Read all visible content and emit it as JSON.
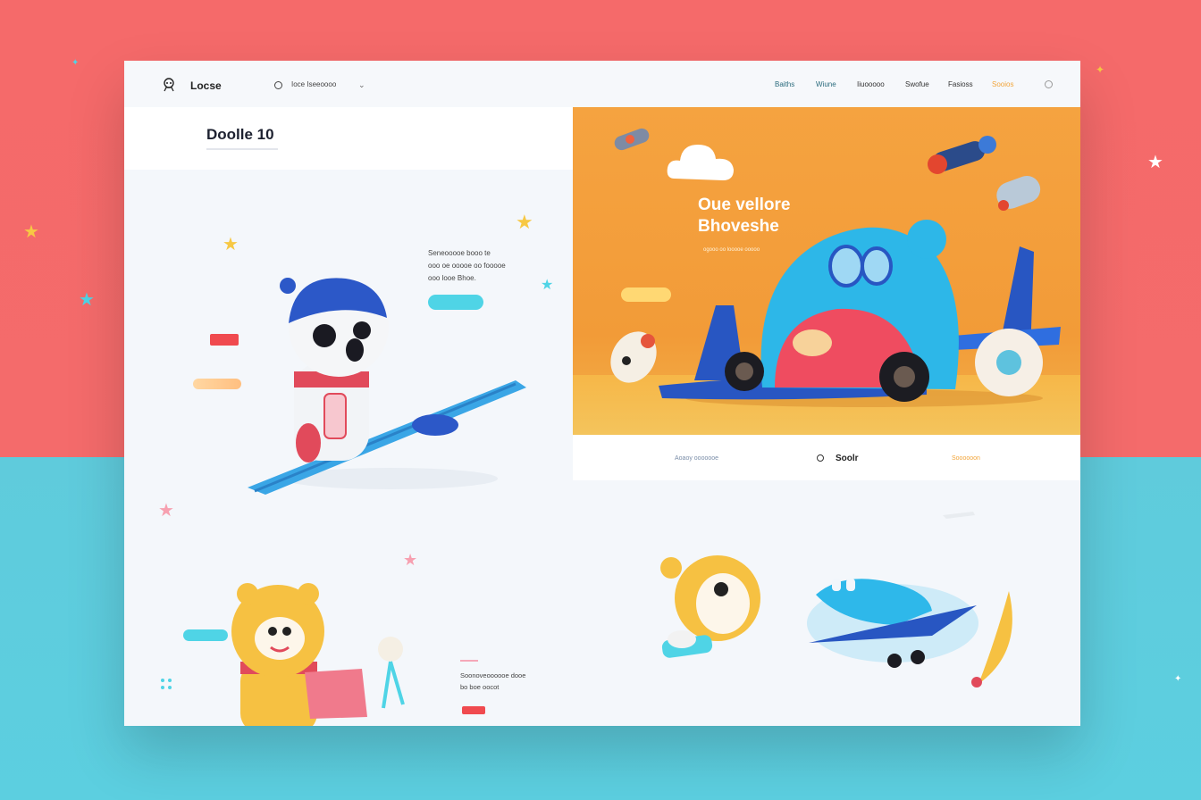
{
  "header": {
    "logo_text": "Locse",
    "search_label": "Ioce Iseeoooo",
    "nav": [
      "Baiths",
      "Wiune",
      "Iiuooooo",
      "Swofue",
      "Fasioss",
      "Sooios"
    ]
  },
  "left": {
    "page_title": "Doolle 10",
    "hero_lines": [
      "Seneooooe booo te",
      "ooo oe ooooe oo fooooe",
      "ooo looe Bhoe."
    ],
    "bottom_lines": [
      "Soonoveoooooe dooe",
      "bo boe oocot"
    ]
  },
  "panel": {
    "title_line1": "Oue vellore",
    "title_line2": "Bhoveshe",
    "subtitle": "ogooo oo looooe ooooo"
  },
  "strip": {
    "left_link": "Aoaoy ooooooe",
    "center_label": "Soolr",
    "right_link": "Soooooon"
  },
  "colors": {
    "coral_background": "#f46b6b",
    "cyan_background": "#5ccfe0",
    "orange_panel": "#f5a340",
    "accent_cyan": "#4fd4e6",
    "accent_red": "#f04a4f"
  },
  "icons": [
    "logo-icon",
    "search-icon",
    "chevron-down-icon",
    "user-icon",
    "grid-icon"
  ]
}
